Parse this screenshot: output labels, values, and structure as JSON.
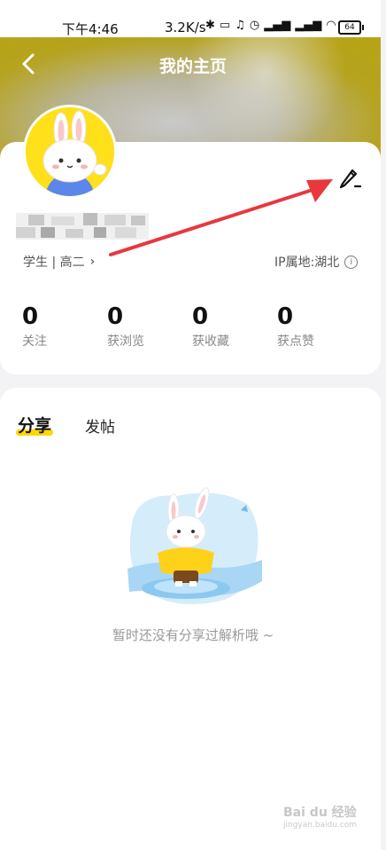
{
  "status_bar": {
    "time": "下午4:46",
    "speed": "3.2K/s",
    "icons": [
      "bluetooth-icon",
      "vibrate-icon",
      "mute-icon",
      "alarm-icon",
      "hd-signal-icon",
      "hd-signal-icon",
      "wifi-icon"
    ],
    "battery": "64"
  },
  "header": {
    "title": "我的主页"
  },
  "profile": {
    "role": "学生 | 高二",
    "ip_location": "IP属地:湖北",
    "stats": [
      {
        "value": "0",
        "label": "关注"
      },
      {
        "value": "0",
        "label": "获浏览"
      },
      {
        "value": "0",
        "label": "获收藏"
      },
      {
        "value": "0",
        "label": "获点赞"
      }
    ]
  },
  "tabs": [
    {
      "label": "分享",
      "active": true
    },
    {
      "label": "发帖",
      "active": false
    }
  ],
  "empty_state": {
    "text": "暂时还没有分享过解析哦 ~"
  },
  "watermark": {
    "logo": "Bai du 经验",
    "url": "jingyan.baidu.com"
  },
  "colors": {
    "accent": "#ffd800",
    "annotation_arrow": "#e8383d"
  }
}
